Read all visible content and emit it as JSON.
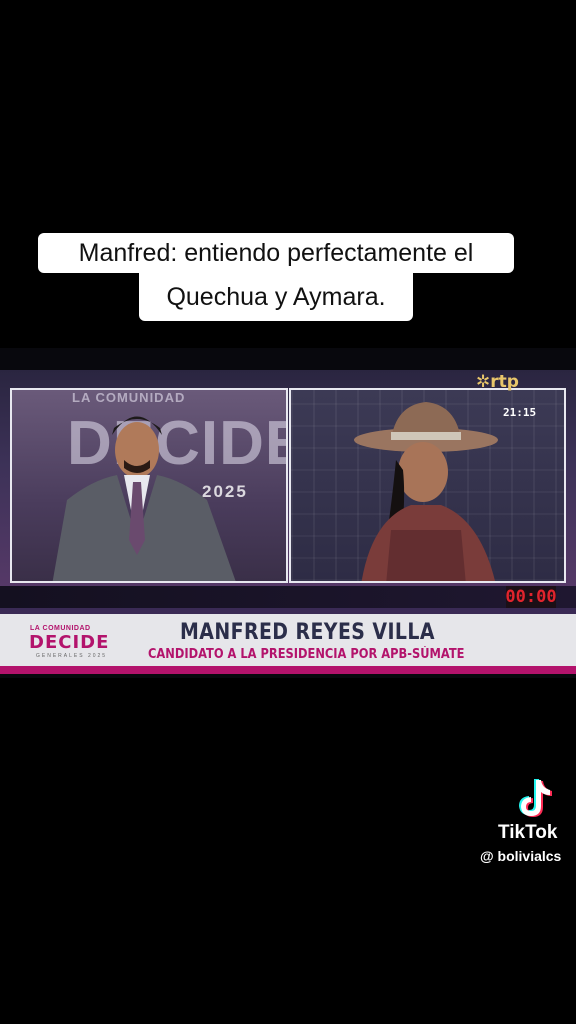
{
  "caption": {
    "line1": "Manfred: entiendo perfectamente el",
    "line2": "Quechua y Aymara."
  },
  "broadcast": {
    "channel_logo": "rtp",
    "clock": "21:15",
    "timer": "00:00",
    "backdrop": {
      "small": "LA COMUNIDAD",
      "big": "DECIDE",
      "year": "2025"
    },
    "lower_third": {
      "logo_small": "LA COMUNIDAD",
      "logo_big": "DECIDE",
      "logo_tiny": "GENERALES 2025",
      "name": "MANFRED REYES VILLA",
      "subtitle": "CANDIDATO A LA PRESIDENCIA POR APB-SÚMATE"
    }
  },
  "tiktok": {
    "brand": "TikTok",
    "username": "@ bolivialcs",
    "icon": "tiktok-logo-icon"
  },
  "colors": {
    "accent_magenta": "#b3136c",
    "timer_red": "#e0242d",
    "name_navy": "#2b2e4a"
  }
}
